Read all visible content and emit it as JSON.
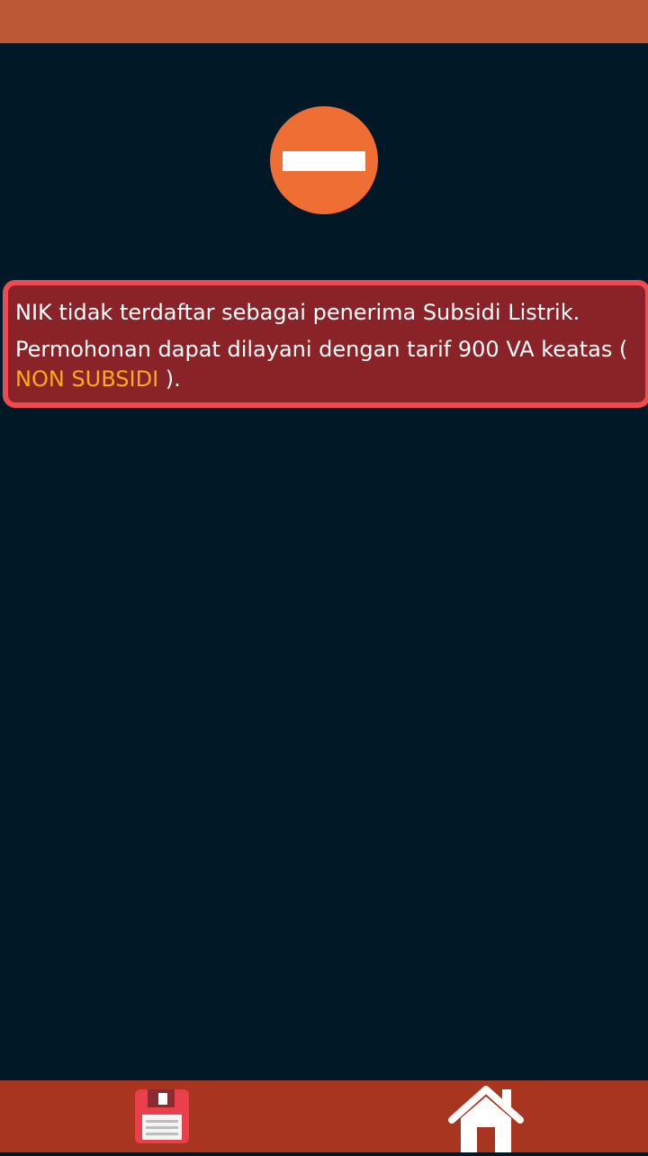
{
  "message": {
    "line1": "NIK tidak terdaftar sebagai penerima Subsidi Listrik.",
    "line2_prefix": "Permohonan dapat dilayani dengan tarif 900 VA keatas ( ",
    "line2_highlight": "NON SUBSIDI",
    "line2_suffix": " )."
  },
  "icons": {
    "status": "no-entry-icon",
    "save": "floppy-disk-icon",
    "home": "home-icon"
  },
  "colors": {
    "background": "#011827",
    "top_bar": "#bc5836",
    "bottom_bar": "#a8351f",
    "status_icon": "#ef6e33",
    "message_bg": "#892328",
    "message_border": "#ef4a51",
    "highlight": "#fbaa1b"
  }
}
